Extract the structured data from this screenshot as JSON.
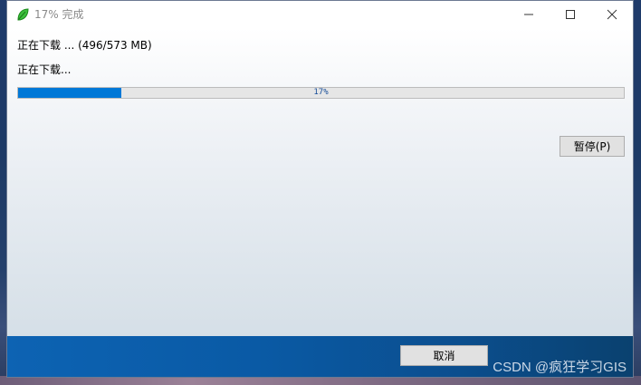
{
  "window": {
    "title": "17% 完成"
  },
  "status": {
    "line1": "正在下载 ... (496/573 MB)",
    "line2": "正在下载..."
  },
  "progress": {
    "percent": 17,
    "label": "17%",
    "fill_color": "#0078d7"
  },
  "buttons": {
    "pause": "暂停(P)",
    "cancel": "取消"
  },
  "icons": {
    "app": "green-leaf-icon",
    "minimize": "minimize-icon",
    "maximize": "maximize-icon",
    "close": "close-icon"
  },
  "watermark": "CSDN @疯狂学习GIS",
  "colors": {
    "accent": "#0078d7",
    "footer": "#0a5aa5"
  }
}
